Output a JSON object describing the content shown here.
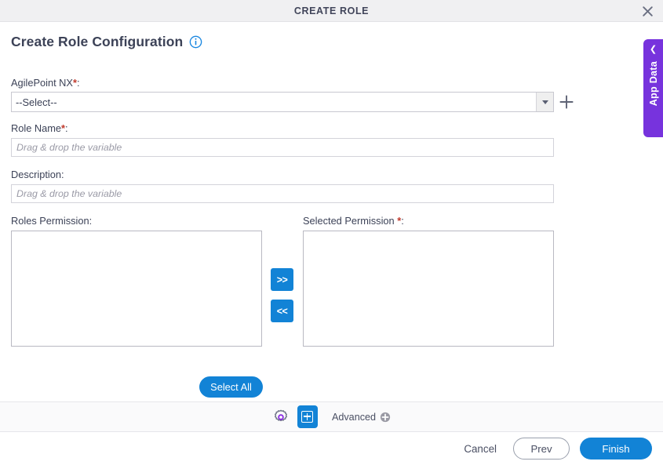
{
  "window": {
    "title": "CREATE ROLE",
    "close_icon": "close-icon"
  },
  "heading": {
    "text": "Create Role Configuration",
    "info_icon": "info-icon"
  },
  "app_data_tab": {
    "label": "App Data",
    "chevron_icon": "chevron-left-icon"
  },
  "form": {
    "agilepoint": {
      "label": "AgilePoint NX",
      "required_marker": "*",
      "colon": ":",
      "selected_value": "--Select--",
      "dropdown_icon": "chevron-down-icon",
      "add_icon": "plus-icon"
    },
    "role_name": {
      "label": "Role Name",
      "required_marker": "*",
      "colon": ":",
      "value": "",
      "placeholder": "Drag & drop the variable"
    },
    "description": {
      "label": "Description",
      "colon": ":",
      "value": "",
      "placeholder": "Drag & drop the variable"
    },
    "roles_permission": {
      "label": "Roles Permission",
      "colon": ":",
      "items": []
    },
    "selected_permission": {
      "label": "Selected Permission",
      "required_marker": "*",
      "colon": ":",
      "items": []
    },
    "transfer": {
      "move_right_label": ">>",
      "move_left_label": "<<"
    },
    "select_all_label": "Select All"
  },
  "toolbar": {
    "gear_icon": "gear-icon",
    "add_block_icon": "add-square-icon",
    "advanced_label": "Advanced",
    "advanced_plus_icon": "plus-circle-icon"
  },
  "footer": {
    "cancel_label": "Cancel",
    "prev_label": "Prev",
    "finish_label": "Finish"
  },
  "colors": {
    "accent_blue": "#1283d6",
    "app_data_purple": "#7733dd",
    "required_red": "#c0392b",
    "titlebar_bg": "#f0f0f2",
    "text_dark": "#3c4257"
  }
}
